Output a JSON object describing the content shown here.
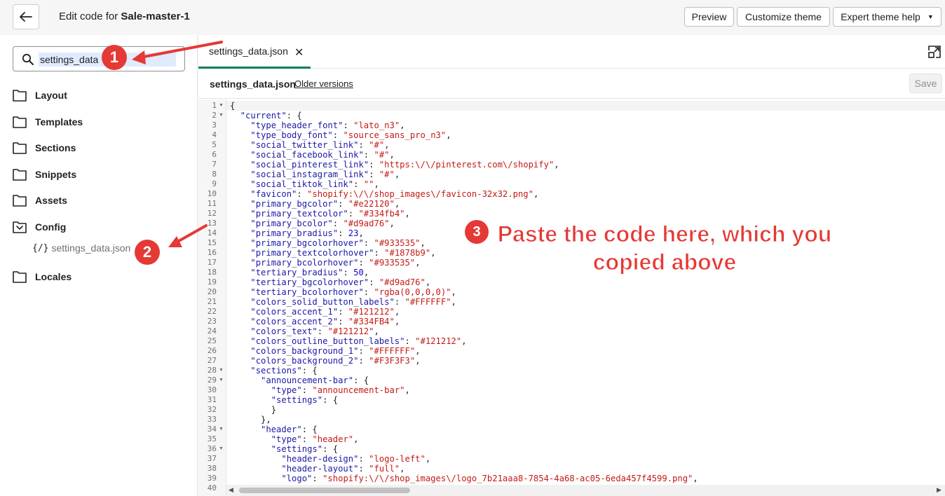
{
  "topbar": {
    "title_prefix": "Edit code for ",
    "theme_name": "Sale-master-1",
    "preview_label": "Preview",
    "customize_label": "Customize theme",
    "expert_label": "Expert theme help"
  },
  "sidebar": {
    "search_value": "settings_data",
    "folders": [
      "Layout",
      "Templates",
      "Sections",
      "Snippets",
      "Assets",
      "Config",
      "Locales"
    ],
    "config_file": "settings_data.json",
    "file_braces": "{/}"
  },
  "editor": {
    "tab_name": "settings_data.json",
    "tab_close": "✕",
    "file_name": "settings_data.json",
    "older_versions": "Older versions",
    "save_label": "Save"
  },
  "code_lines": [
    "{",
    "  \"current\": {",
    "    \"type_header_font\": \"lato_n3\",",
    "    \"type_body_font\": \"source_sans_pro_n3\",",
    "    \"social_twitter_link\": \"#\",",
    "    \"social_facebook_link\": \"#\",",
    "    \"social_pinterest_link\": \"https:\\/\\/pinterest.com\\/shopify\",",
    "    \"social_instagram_link\": \"#\",",
    "    \"social_tiktok_link\": \"\",",
    "    \"favicon\": \"shopify:\\/\\/shop_images\\/favicon-32x32.png\",",
    "    \"primary_bgcolor\": \"#e22120\",",
    "    \"primary_textcolor\": \"#334fb4\",",
    "    \"primary_bcolor\": \"#d9ad76\",",
    "    \"primary_bradius\": 23,",
    "    \"primary_bgcolorhover\": \"#933535\",",
    "    \"primary_textcolorhover\": \"#1878b9\",",
    "    \"primary_bcolorhover\": \"#933535\",",
    "    \"tertiary_bradius\": 50,",
    "    \"tertiary_bgcolorhover\": \"#d9ad76\",",
    "    \"tertiary_bcolorhover\": \"rgba(0,0,0,0)\",",
    "    \"colors_solid_button_labels\": \"#FFFFFF\",",
    "    \"colors_accent_1\": \"#121212\",",
    "    \"colors_accent_2\": \"#334FB4\",",
    "    \"colors_text\": \"#121212\",",
    "    \"colors_outline_button_labels\": \"#121212\",",
    "    \"colors_background_1\": \"#FFFFFF\",",
    "    \"colors_background_2\": \"#F3F3F3\",",
    "    \"sections\": {",
    "      \"announcement-bar\": {",
    "        \"type\": \"announcement-bar\",",
    "        \"settings\": {",
    "        }",
    "      },",
    "      \"header\": {",
    "        \"type\": \"header\",",
    "        \"settings\": {",
    "          \"header-design\": \"logo-left\",",
    "          \"header-layout\": \"full\",",
    "          \"logo\": \"shopify:\\/\\/shop_images\\/logo_7b21aaa8-7854-4a68-ac05-6eda457f4599.png\",",
    ""
  ],
  "fold_lines": [
    1,
    2,
    28,
    29,
    34,
    36
  ],
  "annotations": {
    "badge_1": "1",
    "badge_2": "2",
    "badge_3": "3",
    "note_line_1": "Paste the code here, which you",
    "note_line_2": "copied above"
  },
  "colors": {
    "accent_green": "#008060",
    "annotation_red": "#e53935",
    "string_red": "#c41a16",
    "key_blue": "#1a1aa6",
    "number_blue": "#1c00cf"
  }
}
